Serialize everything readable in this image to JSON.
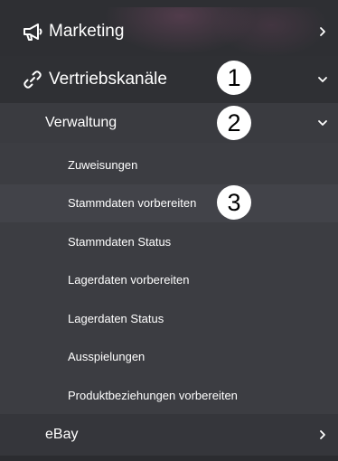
{
  "nav": {
    "marketing": {
      "label": "Marketing",
      "icon": "megaphone-icon",
      "chevron": "chevron-right-icon"
    },
    "vertriebskanaele": {
      "label": "Vertriebskanäle",
      "icon": "link-icon",
      "chevron": "chevron-down-icon"
    },
    "verwaltung": {
      "label": "Verwaltung",
      "chevron": "chevron-down-icon"
    },
    "items": [
      {
        "label": "Zuweisungen"
      },
      {
        "label": "Stammdaten vorbereiten"
      },
      {
        "label": "Stammdaten Status"
      },
      {
        "label": "Lagerdaten vorbereiten"
      },
      {
        "label": "Lagerdaten Status"
      },
      {
        "label": "Ausspielungen"
      },
      {
        "label": "Produktbeziehungen vorbereiten"
      }
    ],
    "ebay": {
      "label": "eBay",
      "chevron": "chevron-right-icon"
    }
  },
  "annotations": {
    "badge_1": "1",
    "badge_2": "2",
    "badge_3": "3"
  },
  "colors": {
    "background": "#2b2c30",
    "submenu_bg": "#3a3b40",
    "list_bg": "#3c3d42",
    "text": "#ffffff",
    "badge_bg": "#ffffff",
    "badge_text": "#000000"
  }
}
